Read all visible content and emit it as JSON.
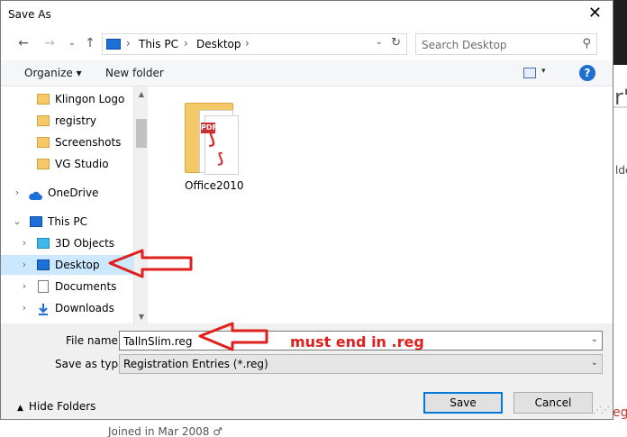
{
  "window": {
    "title": "Save As",
    "close_glyph": "✕"
  },
  "nav": {
    "back_glyph": "←",
    "forward_glyph": "→",
    "recent_glyph": "⌄",
    "up_glyph": "↑"
  },
  "address": {
    "crumbs": [
      "This PC",
      "Desktop"
    ],
    "separator": "›",
    "dropdown_glyph": "⌄",
    "refresh_glyph": "↻"
  },
  "search": {
    "placeholder": "Search Desktop",
    "icon": "magnifier-icon",
    "glyph": "⚲"
  },
  "toolbar": {
    "organize_label": "Organize ▾",
    "new_folder_label": "New folder",
    "view_dropdown_glyph": "▾",
    "help_glyph": "?"
  },
  "tree": {
    "items": [
      {
        "label": "Klingon Logo",
        "icon": "folder-icon"
      },
      {
        "label": "registry",
        "icon": "folder-icon"
      },
      {
        "label": "Screenshots",
        "icon": "folder-icon"
      },
      {
        "label": "VG Studio",
        "icon": "folder-icon"
      },
      {
        "label": "OneDrive",
        "icon": "cloud-icon"
      },
      {
        "label": "This PC",
        "icon": "pc-icon"
      },
      {
        "label": "3D Objects",
        "icon": "cube-icon"
      },
      {
        "label": "Desktop",
        "icon": "desktop-icon"
      },
      {
        "label": "Documents",
        "icon": "document-icon"
      },
      {
        "label": "Downloads",
        "icon": "download-icon"
      }
    ],
    "chevron_collapsed": "›",
    "chevron_expanded": "⌄",
    "selected": "Desktop"
  },
  "scroll": {
    "up_glyph": "▲",
    "down_glyph": "▼"
  },
  "files": [
    {
      "name": "Office2010",
      "icon": "pdf-folder-icon"
    }
  ],
  "form": {
    "filename_label": "File name:",
    "filename_value": "TallnSlim.reg",
    "filetype_label": "Save as type:",
    "filetype_value": "Registration Entries (*.reg)",
    "dropdown_glyph": "⌄"
  },
  "footer": {
    "hide_folders_label": "Hide Folders",
    "hide_caret": "▲",
    "save_label": "Save",
    "cancel_label": "Cancel"
  },
  "annotation": {
    "text": "must end in .reg",
    "color": "#e0201c"
  },
  "background_page": {
    "heading_fragment": "r's",
    "side_fragment": "lde",
    "red_fragment": "eg",
    "joined_text": "Joined in Mar 2008 ♂"
  }
}
